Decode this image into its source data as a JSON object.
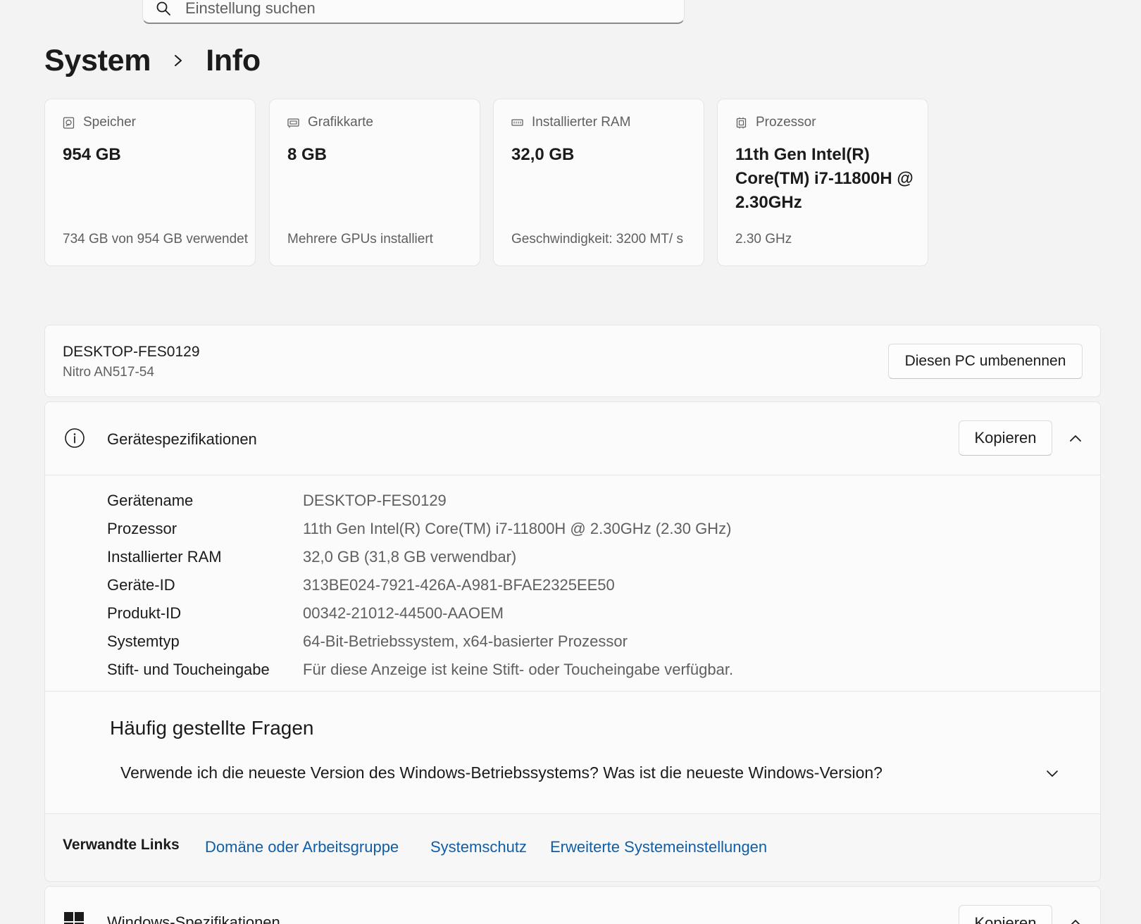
{
  "search": {
    "placeholder": "Einstellung suchen"
  },
  "breadcrumb": {
    "parent": "System",
    "current": "Info"
  },
  "cards": [
    {
      "icon": "storage-icon",
      "title": "Speicher",
      "value": "954 GB",
      "sub": "734 GB von 954 GB verwendet"
    },
    {
      "icon": "graphics-card-icon",
      "title": "Grafikkarte",
      "value": "8 GB",
      "sub": "Mehrere GPUs installiert"
    },
    {
      "icon": "ram-icon",
      "title": "Installierter RAM",
      "value": "32,0 GB",
      "sub": "Geschwindigkeit: 3200 MT/ s"
    },
    {
      "icon": "processor-icon",
      "title": "Prozessor",
      "value": "11th Gen Intel(R) Core(TM) i7-11800H @ 2.30GHz",
      "sub": "2.30 GHz"
    }
  ],
  "device": {
    "name": "DESKTOP-FES0129",
    "model": "Nitro AN517-54",
    "rename_label": "Diesen PC umbenennen"
  },
  "specs": {
    "title": "Gerätespezifikationen",
    "copy_label": "Kopieren",
    "rows": [
      {
        "key": "Gerätename",
        "value": "DESKTOP-FES0129"
      },
      {
        "key": "Prozessor",
        "value": "11th Gen Intel(R) Core(TM) i7-11800H @ 2.30GHz (2.30 GHz)"
      },
      {
        "key": "Installierter RAM",
        "value": "32,0 GB (31,8 GB verwendbar)"
      },
      {
        "key": "Geräte-ID",
        "value": "313BE024-7921-426A-A981-BFAE2325EE50"
      },
      {
        "key": "Produkt-ID",
        "value": "00342-21012-44500-AAOEM"
      },
      {
        "key": "Systemtyp",
        "value": "64-Bit-Betriebssystem, x64-basierter Prozessor"
      },
      {
        "key": "Stift- und Toucheingabe",
        "value": "Für diese Anzeige ist keine Stift- oder Toucheingabe verfügbar."
      }
    ]
  },
  "faq": {
    "title": "Häufig gestellte Fragen",
    "question": "Verwende ich die neueste Version des Windows-Betriebssystems? Was ist die neueste Windows-Version?"
  },
  "related": {
    "title": "Verwandte Links",
    "links": [
      "Domäne oder Arbeitsgruppe",
      "Systemschutz",
      "Erweiterte Systemeinstellungen"
    ]
  },
  "windows_specs": {
    "title": "Windows-Spezifikationen",
    "copy_label": "Kopieren"
  },
  "colors": {
    "link": "#0f5ea6",
    "background": "#f3f3f3",
    "card": "#fbfbfb",
    "secondary_text": "#5f5f5f"
  }
}
